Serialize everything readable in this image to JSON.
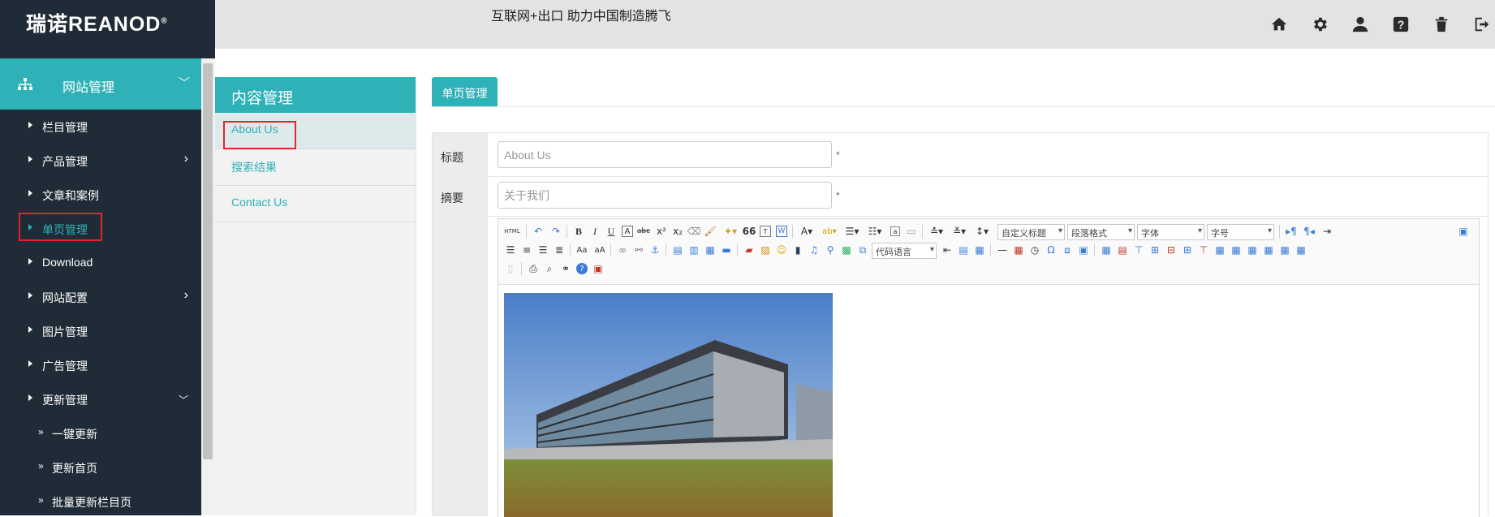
{
  "brand": {
    "name": "瑞诺REANOD",
    "mark": "®"
  },
  "slogan": "互联网+出口  助力中国制造腾飞",
  "top_icons": [
    "home-icon",
    "gear-icon",
    "user-icon",
    "help-icon",
    "trash-icon",
    "logout-icon"
  ],
  "sidebar": {
    "header": "网站管理",
    "items": [
      {
        "label": "栏目管理"
      },
      {
        "label": "产品管理"
      },
      {
        "label": "文章和案例"
      },
      {
        "label": "单页管理"
      },
      {
        "label": "Download"
      },
      {
        "label": "网站配置"
      },
      {
        "label": "图片管理"
      },
      {
        "label": "广告管理"
      },
      {
        "label": "更新管理"
      }
    ],
    "subitems": [
      {
        "label": "一键更新"
      },
      {
        "label": "更新首页"
      },
      {
        "label": "批量更新栏目页"
      }
    ]
  },
  "content_menu": {
    "title": "内容管理",
    "items": [
      {
        "label": "About Us"
      },
      {
        "label": "搜索结果"
      },
      {
        "label": "Contact Us"
      }
    ]
  },
  "main": {
    "tab": "单页管理",
    "fields": {
      "title_label": "标题",
      "title_value": "About Us",
      "summary_label": "摘要",
      "summary_value": "关于我们",
      "required_mark": "*"
    },
    "editor": {
      "selects": {
        "heading": "自定义标题",
        "paragraph": "段落格式",
        "font": "字体",
        "size": "字号",
        "code": "代码语言"
      },
      "buttons": {
        "bold": "B",
        "italic": "I",
        "underline": "U",
        "font_color": "A",
        "quote": "66",
        "omega": "Ω"
      }
    }
  },
  "colors": {
    "accent": "#2fb1b8",
    "sidebar_bg": "#1f2b36",
    "topbar_bg": "#e3e3e3",
    "highlight_border": "#e3242b"
  }
}
